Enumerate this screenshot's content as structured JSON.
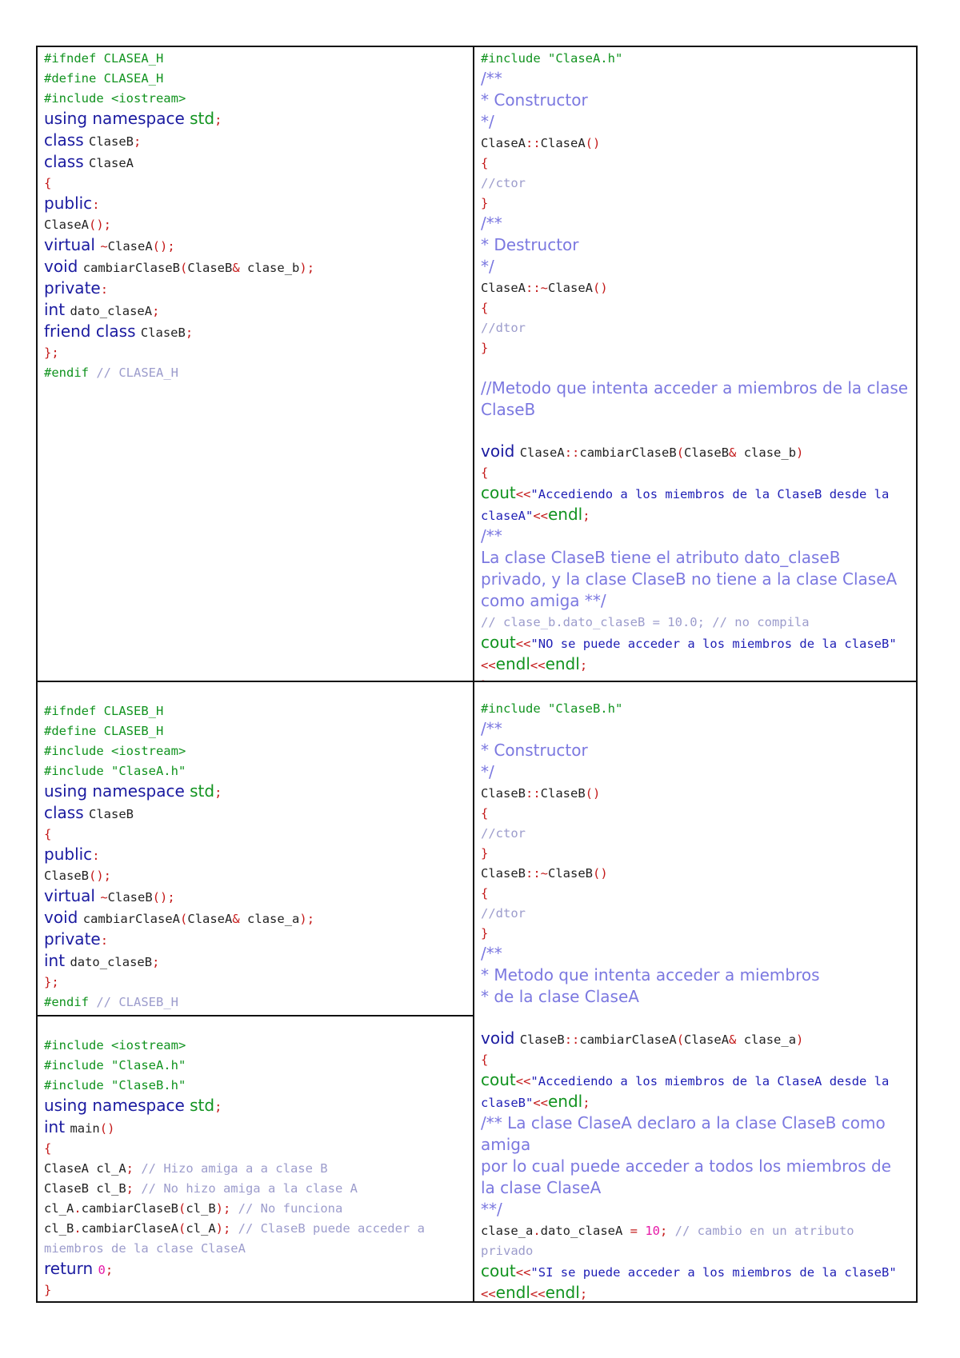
{
  "cells": [
    {
      "id": "clasea-header",
      "lines": [
        [
          [
            "pp",
            "#ifndef CLASEA_H"
          ]
        ],
        [
          [
            "pp",
            "#define CLASEA_H"
          ]
        ],
        [
          [
            "pp",
            "#include <iostream>"
          ]
        ],
        [
          [
            "kw",
            "using namespace "
          ],
          [
            "gr",
            "std"
          ],
          [
            "op",
            ";"
          ]
        ],
        [
          [
            "kw",
            "class "
          ],
          [
            "pl",
            "ClaseB"
          ],
          [
            "op",
            ";"
          ]
        ],
        [
          [
            "kw",
            "class "
          ],
          [
            "pl",
            "ClaseA"
          ]
        ],
        [
          [
            "op",
            "{"
          ]
        ],
        [
          [
            "kw",
            "public"
          ],
          [
            "op",
            ":"
          ]
        ],
        [
          [
            "pl",
            "ClaseA"
          ],
          [
            "op",
            "();"
          ]
        ],
        [
          [
            "kw",
            "virtual "
          ],
          [
            "op",
            "~"
          ],
          [
            "pl",
            "ClaseA"
          ],
          [
            "op",
            "();"
          ]
        ],
        [
          [
            "kw",
            "void "
          ],
          [
            "pl",
            "cambiarClaseB"
          ],
          [
            "op",
            "("
          ],
          [
            "pl",
            "ClaseB"
          ],
          [
            "op",
            "& "
          ],
          [
            "pl",
            "clase_b"
          ],
          [
            "op",
            ");"
          ]
        ],
        [
          [
            "kw",
            "private"
          ],
          [
            "op",
            ":"
          ]
        ],
        [
          [
            "kw",
            "int "
          ],
          [
            "pl",
            "dato_claseA"
          ],
          [
            "op",
            ";"
          ]
        ],
        [
          [
            "kw",
            "friend class "
          ],
          [
            "pl",
            "ClaseB"
          ],
          [
            "op",
            ";"
          ]
        ],
        [
          [
            "op",
            "};"
          ]
        ],
        [
          [
            "pp",
            "#endif "
          ],
          [
            "cm",
            "// CLASEA_H"
          ]
        ]
      ]
    },
    {
      "id": "clasea-source",
      "lines": [
        [
          [
            "pp",
            "#include \"ClaseA.h\""
          ]
        ],
        [
          [
            "dc",
            "/**"
          ]
        ],
        [
          [
            "dc",
            "* Constructor"
          ]
        ],
        [
          [
            "dc",
            "*/"
          ]
        ],
        [
          [
            "pl",
            "ClaseA"
          ],
          [
            "op",
            "::"
          ],
          [
            "pl",
            "ClaseA"
          ],
          [
            "op",
            "()"
          ]
        ],
        [
          [
            "op",
            "{"
          ]
        ],
        [
          [
            "cm",
            "//ctor"
          ]
        ],
        [
          [
            "op",
            "}"
          ]
        ],
        [
          [
            "dc",
            "/**"
          ]
        ],
        [
          [
            "dc",
            "* Destructor"
          ]
        ],
        [
          [
            "dc",
            "*/"
          ]
        ],
        [
          [
            "pl",
            "ClaseA"
          ],
          [
            "op",
            "::~"
          ],
          [
            "pl",
            "ClaseA"
          ],
          [
            "op",
            "()"
          ]
        ],
        [
          [
            "op",
            "{"
          ]
        ],
        [
          [
            "cm",
            "//dtor"
          ]
        ],
        [
          [
            "op",
            "}"
          ]
        ],
        [
          [
            "pl",
            " "
          ]
        ],
        [
          [
            "dc",
            "//Metodo que intenta acceder a miembros de la clase ClaseB"
          ]
        ],
        [
          [
            "pl",
            " "
          ]
        ],
        [
          [
            "kw",
            "void "
          ],
          [
            "pl",
            "ClaseA"
          ],
          [
            "op",
            "::"
          ],
          [
            "pl",
            "cambiarClaseB"
          ],
          [
            "op",
            "("
          ],
          [
            "pl",
            "ClaseB"
          ],
          [
            "op",
            "& "
          ],
          [
            "pl",
            "clase_b"
          ],
          [
            "op",
            ")"
          ]
        ],
        [
          [
            "op",
            "{"
          ]
        ],
        [
          [
            "gr",
            "cout"
          ],
          [
            "op",
            "<<"
          ],
          [
            "st",
            "\"Accediendo a los miembros de la ClaseB desde la claseA\""
          ],
          [
            "op",
            "<<"
          ],
          [
            "gr",
            "endl"
          ],
          [
            "op",
            ";"
          ]
        ],
        [
          [
            "dc",
            "/**"
          ]
        ],
        [
          [
            "dc",
            "La clase ClaseB tiene el atributo dato_claseB privado, y la clase ClaseB no tiene a la clase ClaseA como amiga **/"
          ]
        ],
        [
          [
            "cm",
            "// clase_b.dato_claseB = 10.0; // no compila"
          ]
        ],
        [
          [
            "gr",
            "cout"
          ],
          [
            "op",
            "<<"
          ],
          [
            "st",
            "\"NO se puede acceder a los miembros de la claseB\""
          ],
          [
            "op",
            "<<"
          ],
          [
            "gr",
            "endl"
          ],
          [
            "op",
            "<<"
          ],
          [
            "gr",
            "endl"
          ],
          [
            "op",
            ";"
          ]
        ],
        [
          [
            "op",
            "}"
          ]
        ]
      ]
    },
    {
      "id": "claseb-header",
      "lines": [
        [
          [
            "pp",
            "#ifndef CLASEB_H"
          ]
        ],
        [
          [
            "pp",
            "#define CLASEB_H"
          ]
        ],
        [
          [
            "pp",
            "#include <iostream>"
          ]
        ],
        [
          [
            "pp",
            "#include \"ClaseA.h\""
          ]
        ],
        [
          [
            "kw",
            "using namespace "
          ],
          [
            "gr",
            "std"
          ],
          [
            "op",
            ";"
          ]
        ],
        [
          [
            "kw",
            "class "
          ],
          [
            "pl",
            "ClaseB"
          ]
        ],
        [
          [
            "op",
            "{"
          ]
        ],
        [
          [
            "kw",
            "public"
          ],
          [
            "op",
            ":"
          ]
        ],
        [
          [
            "pl",
            "ClaseB"
          ],
          [
            "op",
            "();"
          ]
        ],
        [
          [
            "kw",
            "virtual "
          ],
          [
            "op",
            "~"
          ],
          [
            "pl",
            "ClaseB"
          ],
          [
            "op",
            "();"
          ]
        ],
        [
          [
            "kw",
            "void "
          ],
          [
            "pl",
            "cambiarClaseA"
          ],
          [
            "op",
            "("
          ],
          [
            "pl",
            "ClaseA"
          ],
          [
            "op",
            "& "
          ],
          [
            "pl",
            "clase_a"
          ],
          [
            "op",
            ");"
          ]
        ],
        [
          [
            "kw",
            "private"
          ],
          [
            "op",
            ":"
          ]
        ],
        [
          [
            "kw",
            "int "
          ],
          [
            "pl",
            "dato_claseB"
          ],
          [
            "op",
            ";"
          ]
        ],
        [
          [
            "op",
            "};"
          ]
        ],
        [
          [
            "pp",
            "#endif "
          ],
          [
            "cm",
            "// CLASEB_H"
          ]
        ]
      ]
    },
    {
      "id": "main-source",
      "lines": [
        [
          [
            "pp",
            "#include <iostream>"
          ]
        ],
        [
          [
            "pp",
            "#include \"ClaseA.h\""
          ]
        ],
        [
          [
            "pp",
            "#include \"ClaseB.h\""
          ]
        ],
        [
          [
            "kw",
            "using namespace "
          ],
          [
            "gr",
            "std"
          ],
          [
            "op",
            ";"
          ]
        ],
        [
          [
            "kw",
            "int "
          ],
          [
            "pl",
            "main"
          ],
          [
            "op",
            "()"
          ]
        ],
        [
          [
            "op",
            "{"
          ]
        ],
        [
          [
            "pl",
            "ClaseA cl_A"
          ],
          [
            "op",
            "; "
          ],
          [
            "cm",
            "// Hizo amiga a a clase B"
          ]
        ],
        [
          [
            "pl",
            "ClaseB cl_B"
          ],
          [
            "op",
            "; "
          ],
          [
            "cm",
            "// No hizo amiga a la clase A"
          ]
        ],
        [
          [
            "pl",
            "cl_A"
          ],
          [
            "op",
            "."
          ],
          [
            "pl",
            "cambiarClaseB"
          ],
          [
            "op",
            "("
          ],
          [
            "pl",
            "cl_B"
          ],
          [
            "op",
            "); "
          ],
          [
            "cm",
            "// No funciona"
          ]
        ],
        [
          [
            "pl",
            "cl_B"
          ],
          [
            "op",
            "."
          ],
          [
            "pl",
            "cambiarClaseA"
          ],
          [
            "op",
            "("
          ],
          [
            "pl",
            "cl_A"
          ],
          [
            "op",
            "); "
          ],
          [
            "cm",
            "// ClaseB puede acceder a miembros de la clase ClaseA"
          ]
        ],
        [
          [
            "kw",
            "return "
          ],
          [
            "nm",
            "0"
          ],
          [
            "op",
            ";"
          ]
        ],
        [
          [
            "op",
            "}"
          ]
        ]
      ]
    },
    {
      "id": "claseb-source",
      "lines": [
        [
          [
            "pp",
            "#include \"ClaseB.h\""
          ]
        ],
        [
          [
            "dc",
            "/**"
          ]
        ],
        [
          [
            "dc",
            "* Constructor"
          ]
        ],
        [
          [
            "dc",
            "*/"
          ]
        ],
        [
          [
            "pl",
            "ClaseB"
          ],
          [
            "op",
            "::"
          ],
          [
            "pl",
            "ClaseB"
          ],
          [
            "op",
            "()"
          ]
        ],
        [
          [
            "op",
            "{"
          ]
        ],
        [
          [
            "cm",
            "//ctor"
          ]
        ],
        [
          [
            "op",
            "}"
          ]
        ],
        [
          [
            "pl",
            "ClaseB"
          ],
          [
            "op",
            "::~"
          ],
          [
            "pl",
            "ClaseB"
          ],
          [
            "op",
            "()"
          ]
        ],
        [
          [
            "op",
            "{"
          ]
        ],
        [
          [
            "cm",
            "//dtor"
          ]
        ],
        [
          [
            "op",
            "}"
          ]
        ],
        [
          [
            "dc",
            "/**"
          ]
        ],
        [
          [
            "dc",
            "* Metodo que intenta acceder a miembros"
          ]
        ],
        [
          [
            "dc",
            "* de la clase ClaseA"
          ]
        ],
        [
          [
            "pl",
            " "
          ]
        ],
        [
          [
            "kw",
            "void "
          ],
          [
            "pl",
            "ClaseB"
          ],
          [
            "op",
            "::"
          ],
          [
            "pl",
            "cambiarClaseA"
          ],
          [
            "op",
            "("
          ],
          [
            "pl",
            "ClaseA"
          ],
          [
            "op",
            "& "
          ],
          [
            "pl",
            "clase_a"
          ],
          [
            "op",
            ")"
          ]
        ],
        [
          [
            "op",
            "{"
          ]
        ],
        [
          [
            "gr",
            "cout"
          ],
          [
            "op",
            "<<"
          ],
          [
            "st",
            "\"Accediendo a los miembros de la ClaseA desde la claseB\""
          ],
          [
            "op",
            "<<"
          ],
          [
            "gr",
            "endl"
          ],
          [
            "op",
            ";"
          ]
        ],
        [
          [
            "dc",
            "/** La clase ClaseA declaro a la clase ClaseB como amiga"
          ]
        ],
        [
          [
            "dc",
            "por lo cual puede acceder a todos los miembros de la clase ClaseA"
          ]
        ],
        [
          [
            "dc",
            "**/"
          ]
        ],
        [
          [
            "pl",
            "clase_a"
          ],
          [
            "op",
            "."
          ],
          [
            "pl",
            "dato_claseA "
          ],
          [
            "op",
            "= "
          ],
          [
            "nm",
            "10"
          ],
          [
            "op",
            "; "
          ],
          [
            "cm",
            "// cambio en un atributo privado"
          ]
        ],
        [
          [
            "gr",
            "cout"
          ],
          [
            "op",
            "<<"
          ],
          [
            "st",
            "\"SI se puede acceder a los miembros de la claseB\""
          ],
          [
            "op",
            "<<"
          ],
          [
            "gr",
            "endl"
          ],
          [
            "op",
            "<<"
          ],
          [
            "gr",
            "endl"
          ],
          [
            "op",
            ";"
          ]
        ],
        [
          [
            "op",
            "}"
          ]
        ]
      ]
    }
  ]
}
